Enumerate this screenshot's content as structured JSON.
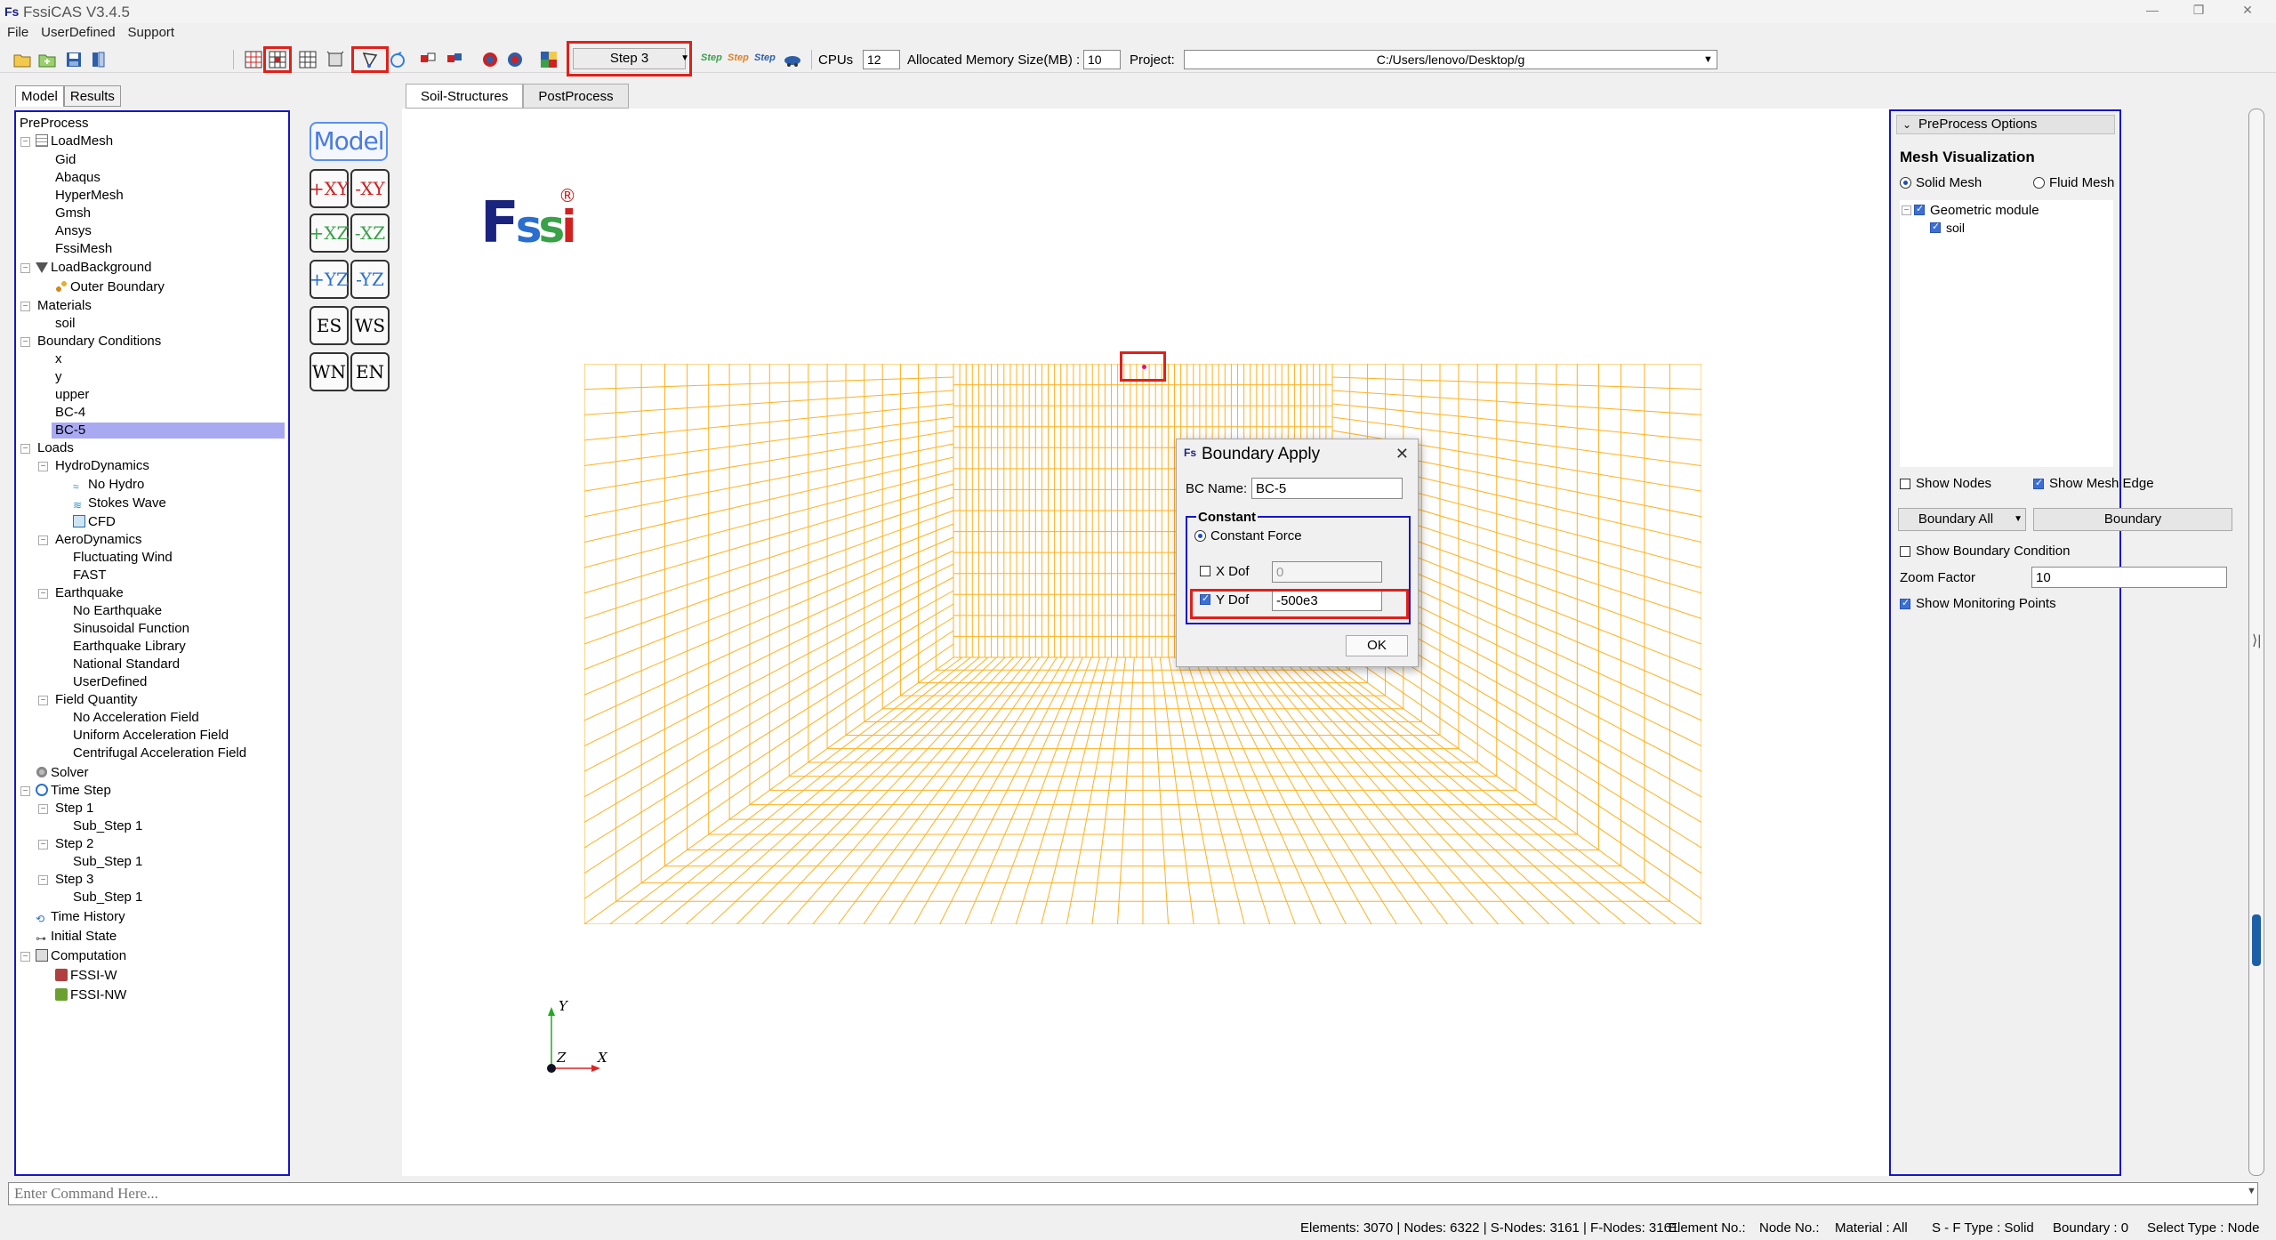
{
  "window": {
    "title": "FssiCAS V3.4.5",
    "app_icon": "Fs"
  },
  "menu": [
    "File",
    "UserDefined",
    "Support"
  ],
  "toolbar": {
    "step": "Step 3",
    "step_icons": [
      "Step",
      "Step",
      "Step"
    ],
    "cpus_label": "CPUs",
    "cpus_value": "12",
    "memory_label": "Allocated Memory Size(MB) :",
    "memory_value": "10",
    "project_label": "Project:",
    "project_value": "C:/Users/lenovo/Desktop/g"
  },
  "left_tabs": [
    "Model",
    "Results"
  ],
  "tree": {
    "preprocess": "PreProcess",
    "loadmesh": "LoadMesh",
    "gid": "Gid",
    "abaqus": "Abaqus",
    "hypermesh": "HyperMesh",
    "gmsh": "Gmsh",
    "ansys": "Ansys",
    "fssimesh": "FssiMesh",
    "loadbackground": "LoadBackground",
    "outer_boundary": "Outer Boundary",
    "materials": "Materials",
    "soil": "soil",
    "boundary_conditions": "Boundary Conditions",
    "bc_x": "x",
    "bc_y": "y",
    "bc_upper": "upper",
    "bc_4": "BC-4",
    "bc_5": "BC-5",
    "loads": "Loads",
    "hydrodynamics": "HydroDynamics",
    "no_hydro": "No Hydro",
    "stokes_wave": "Stokes Wave",
    "cfd": "CFD",
    "aerodynamics": "AeroDynamics",
    "fluctuating_wind": "Fluctuating Wind",
    "fast": "FAST",
    "earthquake": "Earthquake",
    "no_earthquake": "No Earthquake",
    "sinusoidal_function": "Sinusoidal Function",
    "earthquake_library": "Earthquake Library",
    "national_standard": "National Standard",
    "userdefined": "UserDefined",
    "field_quantity": "Field Quantity",
    "no_acceleration_field": "No Acceleration Field",
    "uniform_acceleration_field": "Uniform Acceleration Field",
    "centrifugal_acceleration_field": "Centrifugal Acceleration Field",
    "solver": "Solver",
    "time_step": "Time Step",
    "step1": "Step 1",
    "substep1a": "Sub_Step 1",
    "step2": "Step 2",
    "substep2a": "Sub_Step 1",
    "step3": "Step 3",
    "substep3a": "Sub_Step 1",
    "time_history": "Time History",
    "initial_state": "Initial State",
    "computation": "Computation",
    "fssi_w": "FSSI-W",
    "fssi_nw": "FSSI-NW"
  },
  "view_buttons": {
    "model": "Model",
    "plus_xy": "+XY",
    "minus_xy": "-XY",
    "plus_xz": "+XZ",
    "minus_xz": "-XZ",
    "plus_yz": "+YZ",
    "minus_yz": "-YZ",
    "es": "ES",
    "ws": "WS",
    "wn": "WN",
    "en": "EN"
  },
  "center_tabs": [
    "Soil-Structures",
    "PostProcess"
  ],
  "logo": {
    "text": "Fssi",
    "mark": "®"
  },
  "axis_labels": {
    "y": "Y",
    "x": "X",
    "z": "Z"
  },
  "mesh": {
    "color": "#ffb020",
    "outer_divisions": 17
  },
  "dialog": {
    "title": "Boundary Apply",
    "bc_name_label": "BC Name:",
    "bc_name_value": "BC-5",
    "group_label": "Constant",
    "constant_force_label": "Constant Force",
    "xdof_label": "X Dof",
    "xdof_value": "0",
    "xdof_checked": false,
    "ydof_label": "Y Dof",
    "ydof_value": "-500e3",
    "ydof_checked": true,
    "ok": "OK"
  },
  "right_panel": {
    "header": "PreProcess Options",
    "section": "Mesh Visualization",
    "solid_mesh": "Solid Mesh",
    "fluid_mesh": "Fluid Mesh",
    "geometric_module": "Geometric module",
    "soil": "soil",
    "show_nodes": "Show Nodes",
    "show_mesh_edge": "Show Mesh Edge",
    "boundary_all": "Boundary All",
    "boundary": "Boundary",
    "show_boundary_condition": "Show Boundary Condition",
    "zoom_label": "Zoom Factor",
    "zoom_value": "10",
    "show_monitoring_points": "Show Monitoring Points"
  },
  "command": {
    "placeholder": "Enter Command Here..."
  },
  "status": {
    "mesh_info": "Elements: 3070 | Nodes: 6322 | S-Nodes: 3161 | F-Nodes: 3161",
    "element_no": "Element No.:",
    "node_no": "Node No.:",
    "material": "Material :  All",
    "sf_type": "S - F Type :  Solid",
    "boundary": "Boundary :  0",
    "select_type": "Select Type :  Node"
  },
  "colors": {
    "highlight": "#e0201a",
    "panel_border": "#1515c8",
    "selection": "#a9a9f2",
    "mesh": "#ffb020"
  }
}
